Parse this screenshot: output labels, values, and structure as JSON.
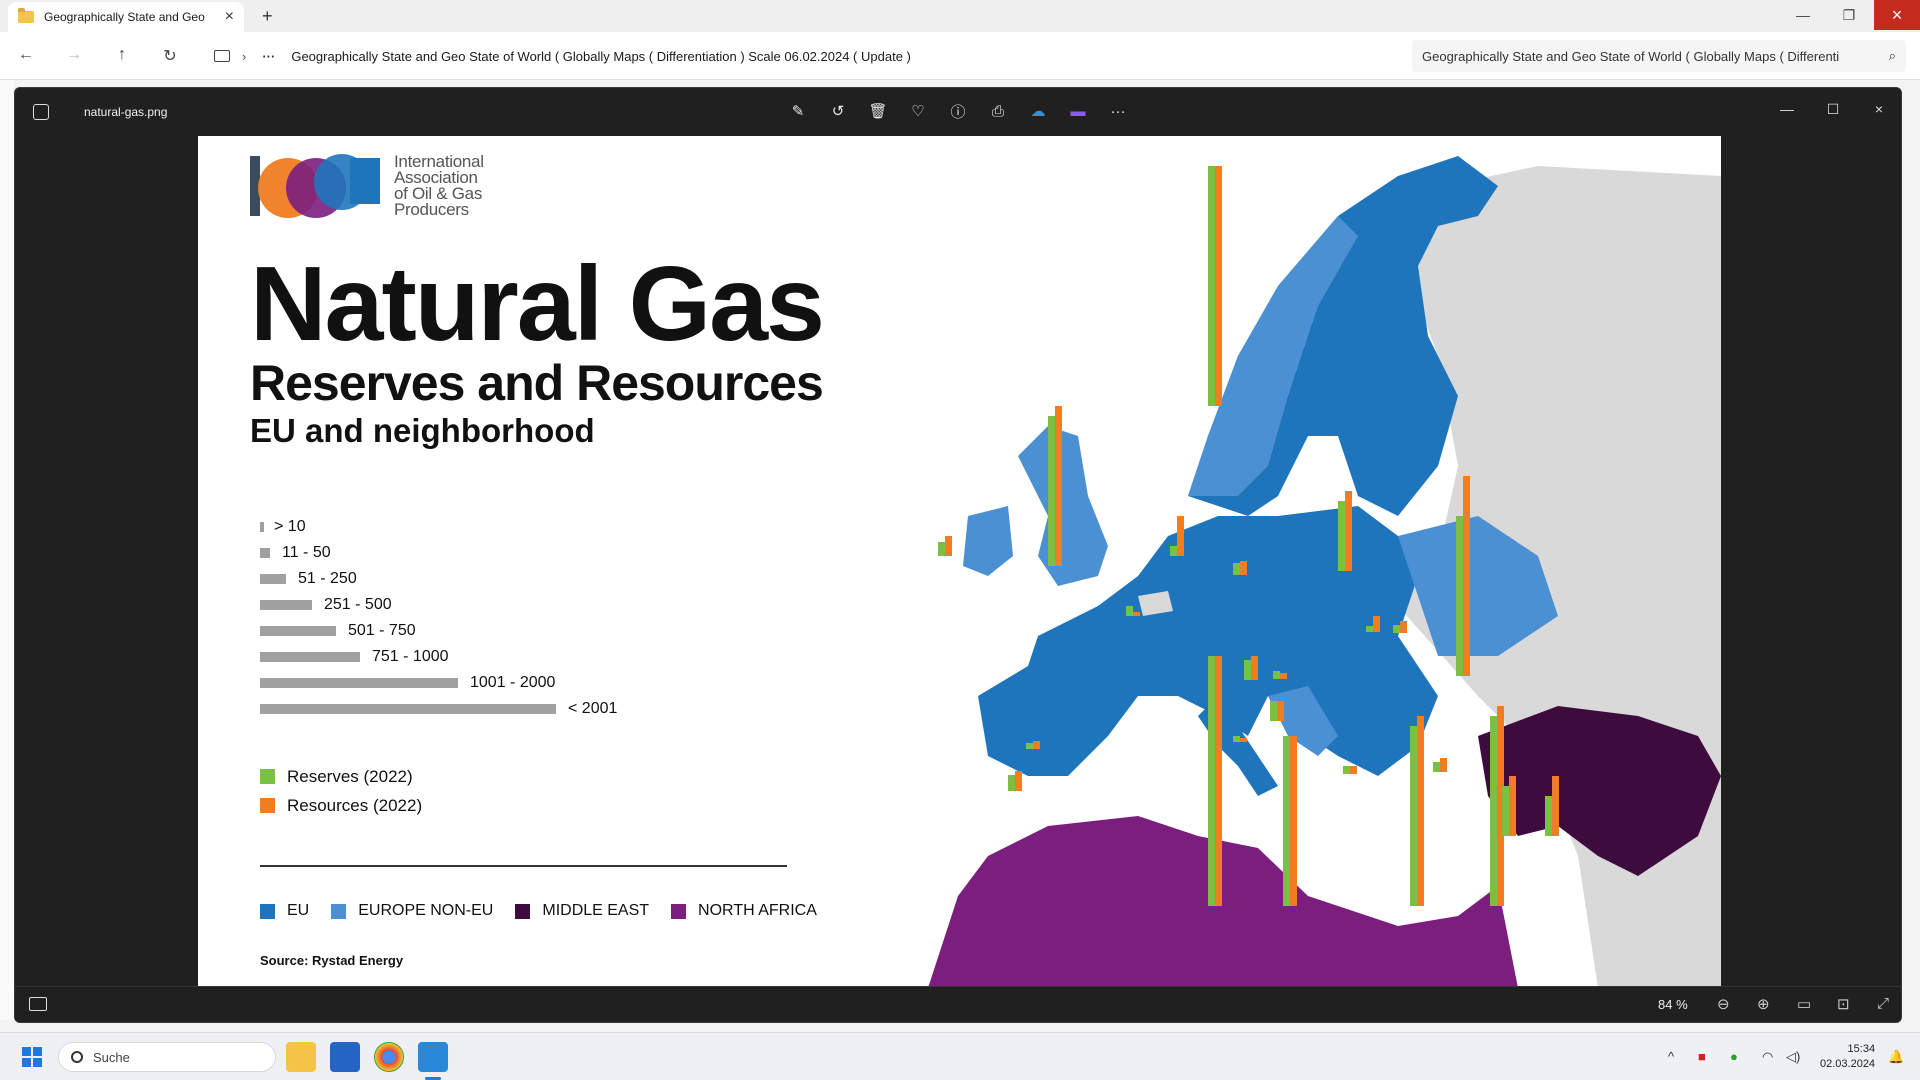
{
  "browser": {
    "tab_title": "Geographically State and Geo",
    "address": "Geographically State and Geo State of World ( Globally Maps ( Differentiation ) Scale 06.02.2024 ( Update )",
    "search_text": "Geographically State and Geo State of World ( Globally Maps ( Differenti"
  },
  "photos": {
    "filename": "natural-gas.png",
    "zoom": "84 %"
  },
  "infographic": {
    "logo_text": [
      "International",
      "Association",
      "of Oil & Gas",
      "Producers"
    ],
    "title": "Natural Gas",
    "subtitle": "Reserves and Resources",
    "subtitle2": "EU and neighborhood",
    "size_legend": [
      "> 10",
      "11 - 50",
      "51 - 250",
      "251 - 500",
      "501 - 750",
      "751 - 1000",
      "1001 - 2000",
      "< 2001"
    ],
    "kind_legend": [
      {
        "label": "Reserves (2022)",
        "color": "#7ac143"
      },
      {
        "label": "Resources (2022)",
        "color": "#ef7d22"
      }
    ],
    "region_legend": [
      {
        "label": "EU",
        "color": "#1f75bc"
      },
      {
        "label": "EUROPE NON-EU",
        "color": "#4a90d2"
      },
      {
        "label": "MIDDLE EAST",
        "color": "#3d0b3d"
      },
      {
        "label": "NORTH AFRICA",
        "color": "#7b1e7e"
      }
    ],
    "source": "Source: Rystad Energy",
    "logo_colors": [
      "#3b4a5c",
      "#f07c22",
      "#7b1e7e",
      "#1f75bc"
    ]
  },
  "taskbar": {
    "search_placeholder": "Suche",
    "time": "15:34",
    "date": "02.03.2024"
  }
}
